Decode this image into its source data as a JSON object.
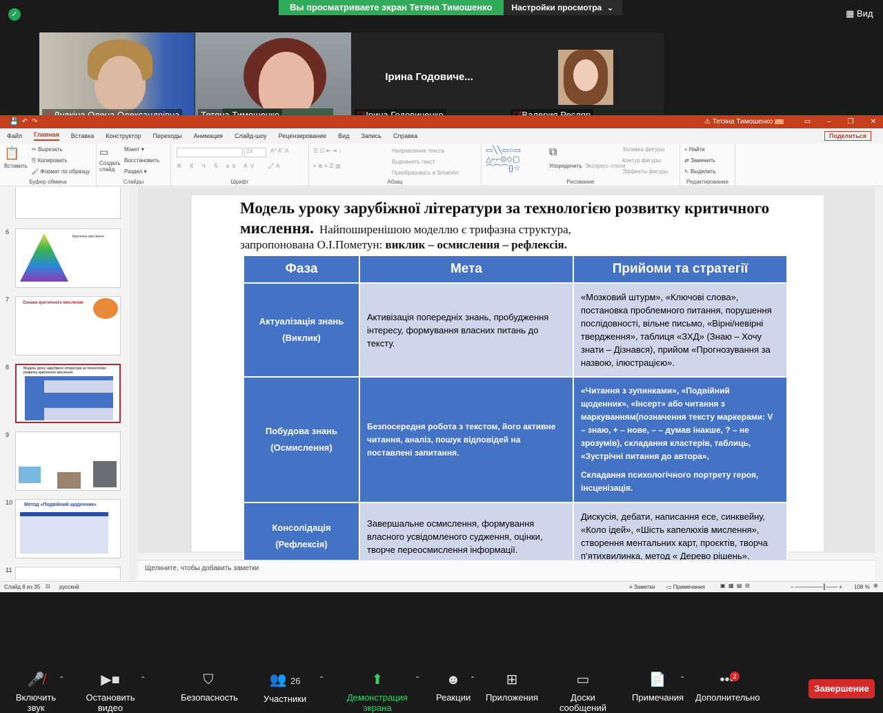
{
  "zoom": {
    "banner_text": "Вы просматриваете экран Тетяна Тимошенко",
    "view_options": "Настройки просмотра",
    "view_button": "Вид",
    "participants": [
      {
        "name": "Дудкіна Олена Олександрівна",
        "muted": true
      },
      {
        "name": "Тетяна Тимошенко",
        "muted": false,
        "active": true
      },
      {
        "name": "Ірина Годовиченко",
        "muted": true,
        "display": "Ірина  Годовиче..."
      },
      {
        "name": "Валерия Ресляр",
        "muted": true
      }
    ],
    "toolbar": {
      "mute": "Включить звук",
      "video": "Остановить видео",
      "security": "Безопасность",
      "participants": "Участники",
      "participants_count": "26",
      "share": "Демонстрация экрана",
      "reactions": "Реакции",
      "apps": "Приложения",
      "whiteboards": "Доски сообщений",
      "notes": "Примечания",
      "more": "Дополнительно",
      "more_badge": "2",
      "end": "Завершение"
    }
  },
  "ppt": {
    "user": "Тетяна Тимошенко",
    "user_initials": "ТТ",
    "tabs": [
      "Файл",
      "Главная",
      "Вставка",
      "Конструктор",
      "Переходы",
      "Анимация",
      "Слайд-шоу",
      "Рецензирование",
      "Вид",
      "Запись",
      "Справка"
    ],
    "share_label": "Поделиться",
    "groups": {
      "clipboard": "Буфер обмена",
      "slides": "Слайды",
      "font": "Шрифт",
      "paragraph": "Абзац",
      "drawing": "Рисование",
      "editing": "Редактирование"
    },
    "clip": {
      "paste": "Вставить",
      "cut": "Вырезать",
      "copy": "Копировать",
      "format": "Формат по образцу"
    },
    "slides_grp": {
      "create": "Создать слайд",
      "layout": "Макет",
      "reset": "Восстановить",
      "section": "Раздел"
    },
    "font_size": "24",
    "para": {
      "direction": "Направление текста",
      "align": "Выровнять текст",
      "smartart": "Преобразовать в SmartArt"
    },
    "draw": {
      "arrange": "Упорядочить",
      "styles": "Экспресс-стили",
      "fill": "Заливка фигуры",
      "outline": "Контур фигуры",
      "effects": "Эффекты фигуры"
    },
    "edit": {
      "find": "Найти",
      "replace": "Заменить",
      "select": "Выделить"
    },
    "thumb_numbers": [
      "6",
      "7",
      "8",
      "9",
      "10",
      "11"
    ],
    "thumb_titles": [
      "Критичне мислення",
      "Ознаки критичного мислення",
      "Модель уроку зарубіжної літератури за технологією розвитку критичного мислення.",
      "",
      "Метод «Подвійний щоденник»",
      ""
    ],
    "notes_placeholder": "Щелкните, чтобы добавить заметки",
    "status": {
      "slide": "Слайд 8 из 35",
      "lang": "русский",
      "notes": "Заметки",
      "comments": "Примечания",
      "zoom": "108 %"
    }
  },
  "slide": {
    "title": "Модель уроку зарубіжної літератури за технологією розвитку критичного мислення.",
    "subtitle_a": "Найпоширенішою моделлю є трифазна структура,",
    "subtitle_b": "запропонована О.І.Пометун:",
    "subtitle_c": "виклик – осмислення – рефлексія.",
    "headers": [
      "Фаза",
      "Мета",
      "Прийоми та стратегії"
    ],
    "rows": [
      {
        "phase": "Актуалізація знань",
        "phase2": "(Виклик)",
        "goal": "Активізація попередніх знань, пробудження інтересу, формування власних питань до тексту.",
        "strategies": "«Мозковий штурм», «Ключові слова», постановка проблемного питання, порушення послідовності, вільне письмо, «Вірні/невірні твердження», таблиця «ЗХД» (Знаю – Хочу знати – Дізнався), прийом «Прогнозування за назвою, ілюстрацією».",
        "strategies2": ""
      },
      {
        "phase": "Побудова знань",
        "phase2": "(Осмислення)",
        "goal": "Безпосередня робота з текстом, його активне читання, аналіз, пошук відповідей на поставлені запитання.",
        "strategies": "«Читання з зупинками», «Подвійний щоденник», «Інсерт» або читання з маркуванням(позначення тексту маркерами: V – знаю, + – нове, – – думав інакше, ? – не зрозумів), складання кластерів, таблиць, «Зустрічні питання до автора»,",
        "strategies2": "Складання психологічного портрету героя, інсценізація."
      },
      {
        "phase": "Консолідація",
        "phase2": "(Рефлексія)",
        "goal": "Завершальне осмислення, формування власного усвідомленого судження, оцінки, творче переосмислення інформації.",
        "strategies": "Дискусія, дебати, написання есе, синквейну, «Коло ідей», «Шість капелюхів мислення», створення ментальних карт, проєктів, творча п’ятихвилинка, метод « Дерево рішень».",
        "strategies2": ""
      }
    ]
  }
}
